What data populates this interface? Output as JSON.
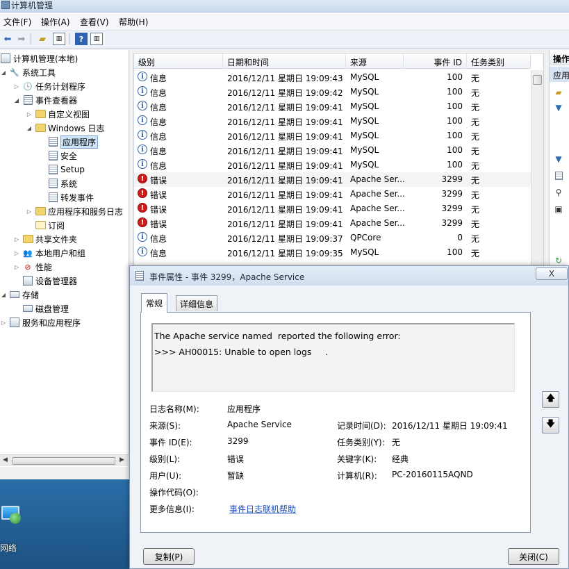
{
  "window": {
    "title": "计算机管理"
  },
  "menu": [
    "文件(F)",
    "操作(A)",
    "查看(V)",
    "帮助(H)"
  ],
  "tree": {
    "nodes": [
      {
        "label": "计算机管理(本地)",
        "icon": "computer-icon",
        "exp": ""
      },
      {
        "label": "系统工具",
        "icon": "tools-icon",
        "exp": "◢"
      },
      {
        "label": "任务计划程序",
        "icon": "clock-icon",
        "exp": "▷"
      },
      {
        "label": "事件查看器",
        "icon": "event-viewer-icon",
        "exp": "◢"
      },
      {
        "label": "自定义视图",
        "icon": "folder-icon",
        "exp": "▷"
      },
      {
        "label": "Windows 日志",
        "icon": "folder-icon",
        "exp": "◢"
      },
      {
        "label": "应用程序",
        "icon": "log-icon",
        "exp": ""
      },
      {
        "label": "安全",
        "icon": "log-icon",
        "exp": ""
      },
      {
        "label": "Setup",
        "icon": "log-icon",
        "exp": ""
      },
      {
        "label": "系统",
        "icon": "log-icon",
        "exp": ""
      },
      {
        "label": "转发事件",
        "icon": "log-icon",
        "exp": ""
      },
      {
        "label": "应用程序和服务日志",
        "icon": "folder-icon",
        "exp": "▷"
      },
      {
        "label": "订阅",
        "icon": "subscription-icon",
        "exp": ""
      },
      {
        "label": "共享文件夹",
        "icon": "shared-folder-icon",
        "exp": "▷"
      },
      {
        "label": "本地用户和组",
        "icon": "users-icon",
        "exp": "▷"
      },
      {
        "label": "性能",
        "icon": "performance-icon",
        "exp": "▷"
      },
      {
        "label": "设备管理器",
        "icon": "device-manager-icon",
        "exp": ""
      },
      {
        "label": "存储",
        "icon": "storage-icon",
        "exp": "◢"
      },
      {
        "label": "磁盘管理",
        "icon": "disk-icon",
        "exp": ""
      },
      {
        "label": "服务和应用程序",
        "icon": "services-icon",
        "exp": "▷"
      }
    ]
  },
  "list": {
    "columns": [
      "级别",
      "日期和时间",
      "来源",
      "事件 ID",
      "任务类别"
    ],
    "rows": [
      {
        "level": "信息",
        "type": "info",
        "datetime": "2016/12/11 星期日 19:09:43",
        "source": "MySQL",
        "id": "100",
        "task": "无"
      },
      {
        "level": "信息",
        "type": "info",
        "datetime": "2016/12/11 星期日 19:09:42",
        "source": "MySQL",
        "id": "100",
        "task": "无"
      },
      {
        "level": "信息",
        "type": "info",
        "datetime": "2016/12/11 星期日 19:09:41",
        "source": "MySQL",
        "id": "100",
        "task": "无"
      },
      {
        "level": "信息",
        "type": "info",
        "datetime": "2016/12/11 星期日 19:09:41",
        "source": "MySQL",
        "id": "100",
        "task": "无"
      },
      {
        "level": "信息",
        "type": "info",
        "datetime": "2016/12/11 星期日 19:09:41",
        "source": "MySQL",
        "id": "100",
        "task": "无"
      },
      {
        "level": "信息",
        "type": "info",
        "datetime": "2016/12/11 星期日 19:09:41",
        "source": "MySQL",
        "id": "100",
        "task": "无"
      },
      {
        "level": "信息",
        "type": "info",
        "datetime": "2016/12/11 星期日 19:09:41",
        "source": "MySQL",
        "id": "100",
        "task": "无"
      },
      {
        "level": "错误",
        "type": "err",
        "datetime": "2016/12/11 星期日 19:09:41",
        "source": "Apache Ser...",
        "id": "3299",
        "task": "无"
      },
      {
        "level": "错误",
        "type": "err",
        "datetime": "2016/12/11 星期日 19:09:41",
        "source": "Apache Ser...",
        "id": "3299",
        "task": "无"
      },
      {
        "level": "错误",
        "type": "err",
        "datetime": "2016/12/11 星期日 19:09:41",
        "source": "Apache Ser...",
        "id": "3299",
        "task": "无"
      },
      {
        "level": "错误",
        "type": "err",
        "datetime": "2016/12/11 星期日 19:09:41",
        "source": "Apache Ser...",
        "id": "3299",
        "task": "无"
      },
      {
        "level": "信息",
        "type": "info",
        "datetime": "2016/12/11 星期日 19:09:37",
        "source": "QPCore",
        "id": "0",
        "task": "无"
      },
      {
        "level": "信息",
        "type": "info",
        "datetime": "2016/12/11 星期日 19:09:35",
        "source": "MySQL",
        "id": "100",
        "task": "无"
      }
    ]
  },
  "actions": {
    "header": "操作",
    "sub": "应用"
  },
  "dialog": {
    "title": "事件属性 - 事件 3299，Apache Service",
    "close": "X",
    "tabs": {
      "general": "常规",
      "details": "详细信息"
    },
    "description": {
      "line1": "The Apache service named  reported the following error:",
      "line2": ">>> AH00015: Unable to open logs     ."
    },
    "fields": {
      "log_name_label": "日志名称(M):",
      "log_name": "应用程序",
      "source_label": "来源(S):",
      "source": "Apache Service",
      "logged_label": "记录时间(D):",
      "logged": "2016/12/11 星期日 19:09:41",
      "event_id_label": "事件 ID(E):",
      "event_id": "3299",
      "task_label": "任务类别(Y):",
      "task": "无",
      "level_label": "级别(L):",
      "level": "错误",
      "keywords_label": "关键字(K):",
      "keywords": "经典",
      "user_label": "用户(U):",
      "user": "暂缺",
      "computer_label": "计算机(R):",
      "computer": "PC-20160115AQND",
      "opcode_label": "操作代码(O):",
      "more_info_label": "更多信息(I):",
      "more_info_link": "事件日志联机帮助"
    },
    "buttons": {
      "copy": "复制(P)",
      "close": "关闭(C)"
    }
  },
  "desktop": {
    "icon_label": "网络"
  }
}
